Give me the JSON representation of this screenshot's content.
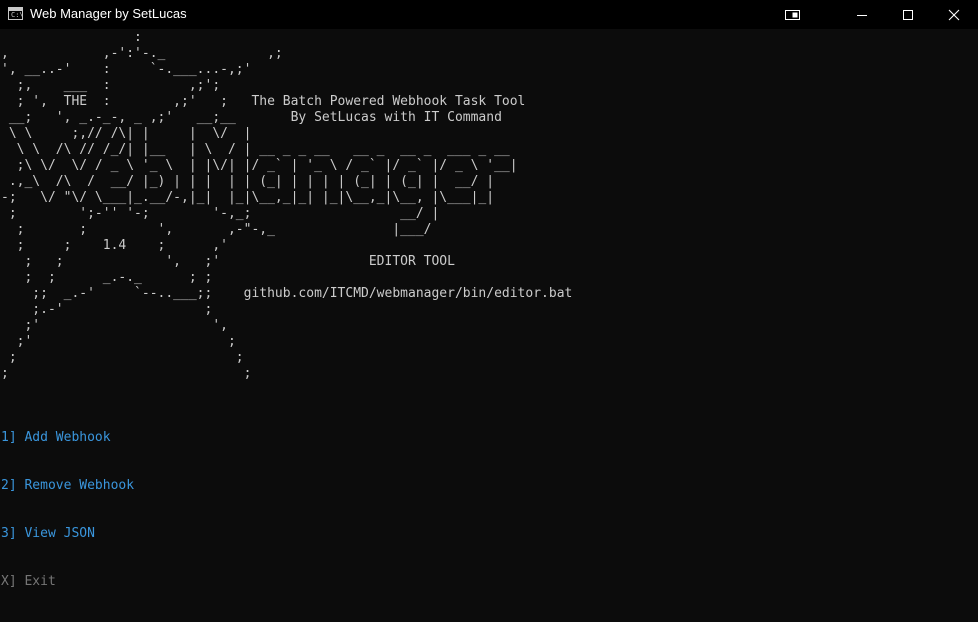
{
  "window": {
    "title": "Web Manager by SetLucas",
    "icon": "console-icon",
    "controls": [
      "snap-icon",
      "minimize-icon",
      "maximize-icon",
      "close-icon"
    ]
  },
  "console": {
    "banner": "                 :\n,            ,-':'-._             ,;\n', __..-'    :     `-.___...-,;'\n  ;,    ___  :          ,;';\n  ; ',  THE  :        ,;'   ;   The Batch Powered Webhook Task Tool\n __;   ', _.-_-, _ ,;'   __;__       By SetLucas with IT Command\n \\ \\     ;,// /\\| |     |  \\/  |\n  \\ \\  /\\ // /_/| |__   | \\  / | __ _ _ __   __ _  __ _  ___ _ __\n  ;\\ \\/  \\/ / _ \\ '_ \\  | |\\/| |/ _` | '_ \\ / _` |/ _` |/ _ \\ '__|\n .,_\\  /\\  /  __/ |_) | | |  | | (_| | | | | (_| | (_| |  __/ |\n-;   \\/ \"\\/ \\___|_.__/-,|_|  |_|\\__,_|_| |_|\\__,_|\\__, |\\___|_|\n ;        ';-'' '-;        '-,_;                   __/ |\n  ;       ;         ',       ,-\"-,_               |___/\n  ;     ;    1.4    ;      ,'\n   ;   ;             ',   ;'                   EDITOR TOOL\n   ;  ;      _.-._      ; ;\n    ;;  _.-'     `--..___;;    github.com/ITCMD/webmanager/bin/editor.bat\n    ;.-'                  ;\n   ;'                      ',\n  ;'                         ;\n ;                            ;\n;                              ;",
    "menu": [
      {
        "key": "1]",
        "label": "Add Webhook"
      },
      {
        "key": "2]",
        "label": "Remove Webhook"
      },
      {
        "key": "3]",
        "label": "View JSON"
      },
      {
        "key": "X]",
        "label": "Exit"
      }
    ]
  },
  "colors": {
    "background": "#0c0c0c",
    "titlebar": "#000000",
    "text": "#cccccc",
    "menu_blue": "#3a96dd",
    "menu_gray": "#767676"
  }
}
